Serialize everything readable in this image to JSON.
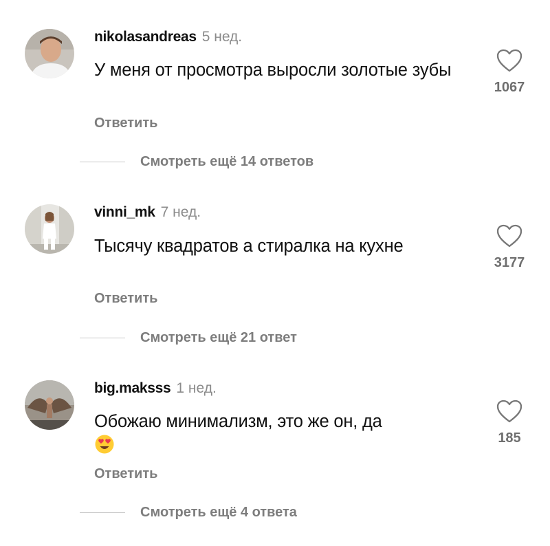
{
  "comments": [
    {
      "username": "nikolasandreas",
      "time": "5 нед.",
      "text": "У меня от просмотра выросли золотые зубы",
      "likes": "1067",
      "reply_label": "Ответить",
      "more_replies": "Смотреть ещё 14 ответов",
      "avatar_icon": "avatar-photo-man"
    },
    {
      "username": "vinni_mk",
      "time": "7 нед.",
      "text": "Тысячу квадратов а стиралка на кухне",
      "likes": "3177",
      "reply_label": "Ответить",
      "more_replies": "Смотреть ещё 21 ответ",
      "avatar_icon": "avatar-photo-woman"
    },
    {
      "username": "big.maksss",
      "time": "1 нед.",
      "text": "Обожаю минимализм, это же он, да",
      "emoji": "heart-eyes-emoji",
      "likes": "185",
      "reply_label": "Ответить",
      "more_replies": "Смотреть ещё 4 ответа",
      "avatar_icon": "avatar-photo-angel"
    }
  ],
  "icons": {
    "like": "heart-outline-icon"
  },
  "colors": {
    "text": "#111111",
    "secondary": "#8b8b8b",
    "reply": "#7d7d7d",
    "divider": "#c8c8c8"
  }
}
